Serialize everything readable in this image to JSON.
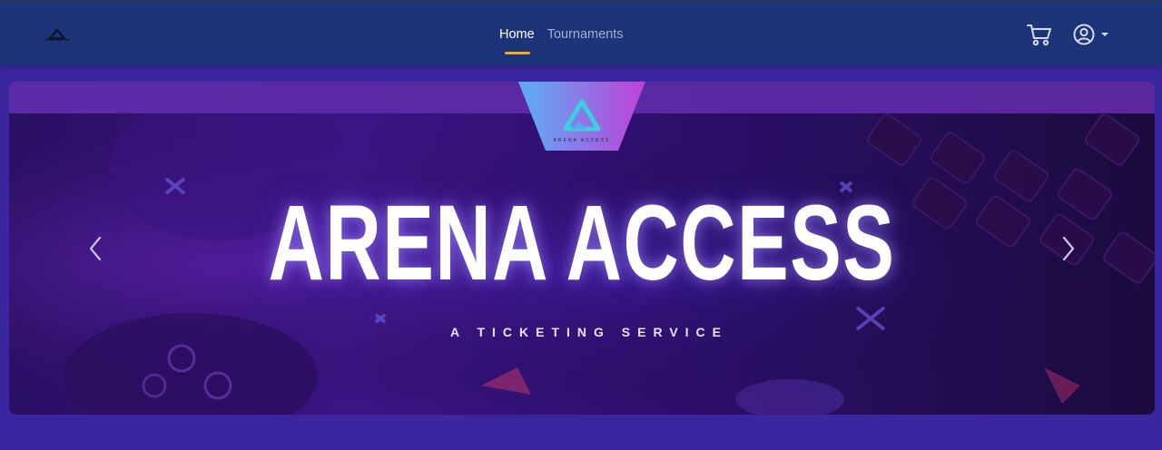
{
  "nav": {
    "links": [
      {
        "label": "Home",
        "active": true
      },
      {
        "label": "Tournaments",
        "active": false
      }
    ],
    "icons": {
      "logo": "arena-logo-icon",
      "cart": "cart-icon",
      "user": "user-circle-icon",
      "dropdown": "caret-down-icon"
    }
  },
  "hero": {
    "title": "ARENA ACCESS",
    "subtitle": "A TICKETING SERVICE",
    "badge_text": "ARENA ACCESS",
    "controls": {
      "prev": "chevron-left-icon",
      "next": "chevron-right-icon"
    }
  },
  "colors": {
    "navbar": "#1c3478",
    "page_background": "#3a27a0",
    "accent_underline": "#f5a623",
    "badge_gradient_start": "#5ab0f5",
    "badge_gradient_end": "#c040d8"
  }
}
